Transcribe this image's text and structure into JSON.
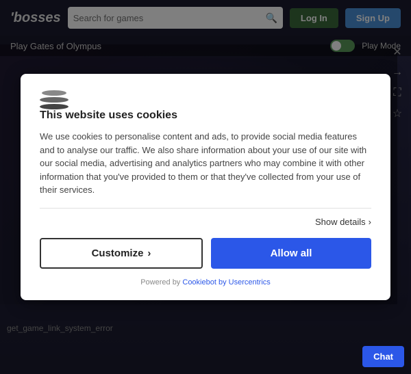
{
  "header": {
    "logo": "'bosses",
    "search_placeholder": "Search for games",
    "login_label": "Log In",
    "signup_label": "Sign Up"
  },
  "subheader": {
    "title": "Play Gates of Olympus",
    "play_mode_label": "Play Mode"
  },
  "side_icons": {
    "arrow_right": "→",
    "expand": "⛶",
    "star": "☆",
    "close": "✕"
  },
  "cookie_modal": {
    "title": "This website uses cookies",
    "body": "We use cookies to personalise content and ads, to provide social media features and to analyse our traffic. We also share information about your use of our site with our social media, advertising and analytics partners who may combine it with other information that you've provided to them or that they've collected from your use of their services.",
    "show_details_label": "Show details",
    "customize_label": "Customize",
    "allow_all_label": "Allow all",
    "powered_by_prefix": "Powered by ",
    "powered_by_link": "Cookiebot by Usercentrics"
  },
  "footer": {
    "error_text": "get_game_link_system_error",
    "chat_label": "Chat"
  }
}
